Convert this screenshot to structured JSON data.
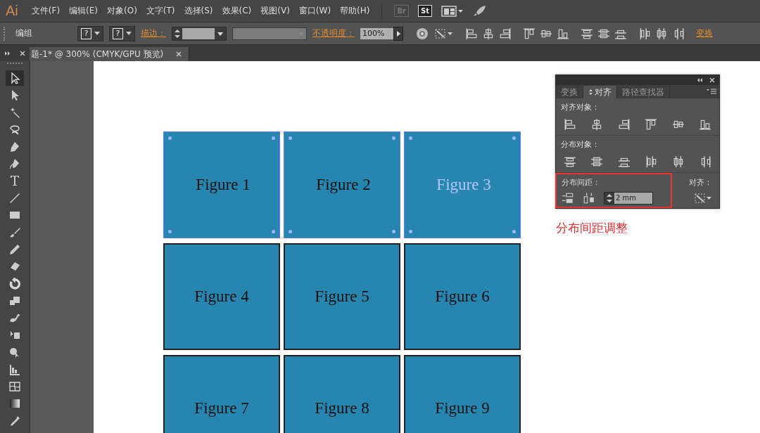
{
  "menu_bar": {
    "logo": "Ai",
    "items": [
      "文件(F)",
      "编辑(E)",
      "对象(O)",
      "文字(T)",
      "选择(S)",
      "效果(C)",
      "视图(V)",
      "窗口(W)",
      "帮助(H)"
    ],
    "apps": [
      {
        "label": "Br",
        "disabled": true
      },
      {
        "label": "St",
        "disabled": false
      }
    ]
  },
  "control_bar": {
    "selection": "编组",
    "fill_swatch": "?",
    "stroke_swatch": "?",
    "stroke_link": "描边：",
    "opacity_link": "不透明度：",
    "opacity_value": "100%",
    "transform_link": "变换"
  },
  "document_tab": {
    "title": "题-1* @ 300% (CMYK/GPU 预览)"
  },
  "toolbox": {
    "tools": [
      {
        "kind": "select",
        "selected": true
      },
      {
        "kind": "direct",
        "selected": false
      },
      {
        "kind": "wand",
        "selected": false
      },
      {
        "kind": "lasso",
        "selected": false
      },
      {
        "kind": "pen",
        "selected": false
      },
      {
        "kind": "curvature",
        "selected": false
      },
      {
        "kind": "type",
        "selected": false
      },
      {
        "kind": "line",
        "selected": false
      },
      {
        "kind": "rect",
        "selected": false
      },
      {
        "kind": "brush",
        "selected": false
      },
      {
        "kind": "pencil",
        "selected": false
      },
      {
        "kind": "eraser",
        "selected": false
      },
      {
        "kind": "rotate",
        "selected": false
      },
      {
        "kind": "scale",
        "selected": false
      },
      {
        "kind": "warp",
        "selected": false
      },
      {
        "kind": "freetransform",
        "selected": false
      },
      {
        "kind": "shapebuilder",
        "selected": false
      },
      {
        "kind": "graph",
        "selected": false
      },
      {
        "kind": "mesh",
        "selected": false
      },
      {
        "kind": "gradient",
        "selected": false
      },
      {
        "kind": "eyedropper",
        "selected": false
      }
    ]
  },
  "artboard": {
    "figures": [
      {
        "label": "Figure 1",
        "selected": true,
        "text_selected": false
      },
      {
        "label": "Figure 2",
        "selected": true,
        "text_selected": false
      },
      {
        "label": "Figure 3",
        "selected": true,
        "text_selected": true
      },
      {
        "label": "Figure 4",
        "selected": false,
        "text_selected": false
      },
      {
        "label": "Figure 5",
        "selected": false,
        "text_selected": false
      },
      {
        "label": "Figure 6",
        "selected": false,
        "text_selected": false
      },
      {
        "label": "Figure 7",
        "selected": false,
        "text_selected": false
      },
      {
        "label": "Figure 8",
        "selected": false,
        "text_selected": false
      },
      {
        "label": "Figure 9",
        "selected": false,
        "text_selected": false
      }
    ]
  },
  "align_panel": {
    "tabs": [
      {
        "label": "变换",
        "selected": false
      },
      {
        "label": "对齐",
        "selected": true
      },
      {
        "label": "路径查找器",
        "selected": false
      }
    ],
    "align_objects_label": "对齐对象：",
    "distribute_objects_label": "分布对象：",
    "distribute_spacing_label": "分布间距：",
    "spacing_value": "2 mm",
    "align_to_label": "对齐："
  },
  "annotation": {
    "label": "分布间距调整"
  }
}
